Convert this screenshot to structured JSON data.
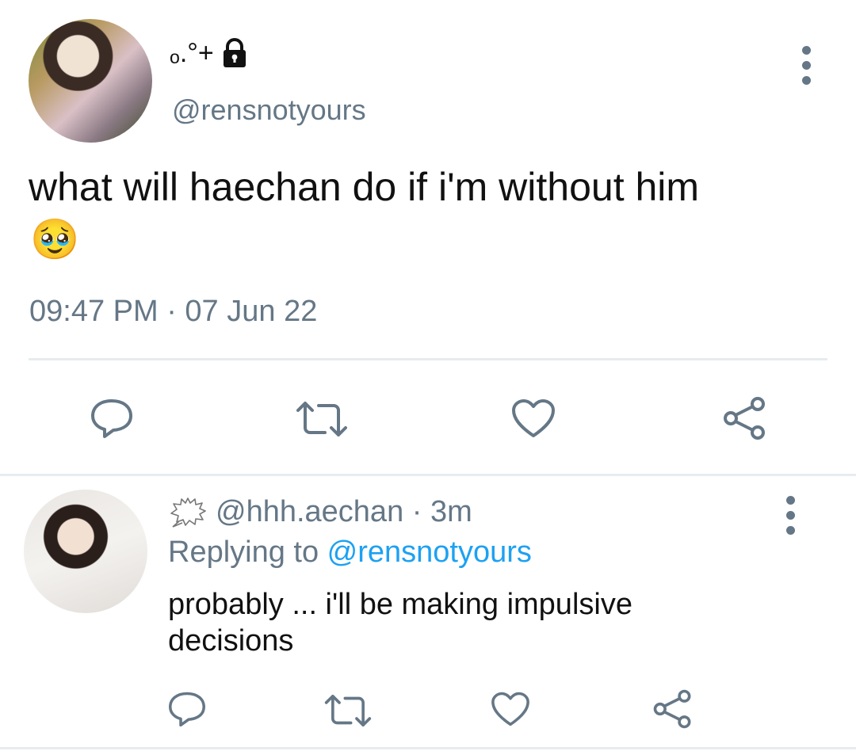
{
  "tweet": {
    "display_name": "ₒ.°+",
    "handle": "@rensnotyours",
    "text": "what will haechan do if i'm without him",
    "emoji": "🥹",
    "timestamp": "09:47 PM · 07 Jun 22",
    "actions": [
      "reply-icon",
      "retweet-icon",
      "like-icon",
      "share-icon"
    ]
  },
  "reply": {
    "handle": "@hhh.aechan",
    "separator": " · ",
    "time": "3m",
    "replying_prefix": "Replying to ",
    "replying_to": "@rensnotyours",
    "text": "probably ... i'll be making impulsive decisions",
    "actions": [
      "reply-icon",
      "retweet-icon",
      "like-icon",
      "share-icon"
    ]
  },
  "colors": {
    "secondary_text": "#657786",
    "mention": "#1da1f2",
    "divider": "#e6ecf0"
  }
}
